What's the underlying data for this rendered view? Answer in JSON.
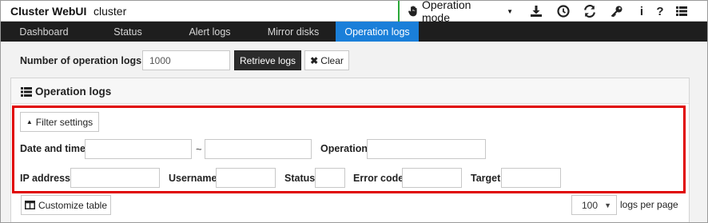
{
  "header": {
    "brand": "Cluster WebUI",
    "cluster_name": "cluster",
    "mode_label": "Operation mode",
    "icons": [
      "download-icon",
      "clock-icon",
      "refresh-icon",
      "key-icon",
      "info-icon",
      "help-icon",
      "list-menu-icon"
    ],
    "info_glyph": "i",
    "help_glyph": "?"
  },
  "tabs": [
    {
      "label": "Dashboard"
    },
    {
      "label": "Status"
    },
    {
      "label": "Alert logs"
    },
    {
      "label": "Mirror disks"
    },
    {
      "label": "Operation logs",
      "active": true
    }
  ],
  "toolbar": {
    "count_label": "Number of operation logs",
    "count_value": "1000",
    "retrieve_label": "Retrieve logs",
    "clear_label": "Clear"
  },
  "panel": {
    "title": "Operation logs",
    "filter_button": "Filter settings",
    "fields": {
      "date_time": "Date and time",
      "date_separator": "~",
      "operation": "Operation",
      "ip_address": "IP address",
      "username": "Username",
      "status": "Status",
      "error_code": "Error code",
      "target": "Target"
    },
    "customize_label": "Customize table",
    "per_page_value": "100",
    "per_page_label": "logs per page"
  },
  "colors": {
    "active_tab": "#1a7fd9",
    "tab_bar": "#1e1e1e",
    "highlight": "#e00000",
    "mode_accent": "#2aa838"
  }
}
